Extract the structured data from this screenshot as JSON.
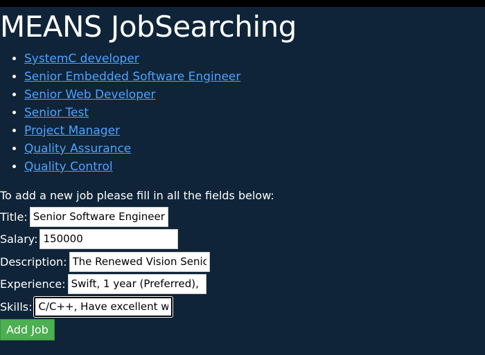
{
  "header": {
    "title": "MEANS JobSearching"
  },
  "jobs": [
    {
      "label": "SystemC developer"
    },
    {
      "label": "Senior Embedded Software Engineer"
    },
    {
      "label": "Senior Web Developer"
    },
    {
      "label": "Senior Test"
    },
    {
      "label": "Project Manager"
    },
    {
      "label": "Quality Assurance"
    },
    {
      "label": "Quality Control"
    }
  ],
  "form": {
    "intro": "To add a new job please fill in all the fields below:",
    "fields": [
      {
        "label": "Title:",
        "value": "Senior Software Engineer"
      },
      {
        "label": "Salary:",
        "value": "150000"
      },
      {
        "label": "Description:",
        "value": "The Renewed Vision Senior Software Engineer"
      },
      {
        "label": "Experience:",
        "value": "Swift, 1 year (Preferred), "
      },
      {
        "label": "Skills:",
        "value": "C/C++, Have excellent written skills"
      }
    ],
    "submit_label": "Add Job"
  },
  "colors": {
    "background": "#0f2438",
    "link": "#4da3ff",
    "button": "#4caf50"
  }
}
